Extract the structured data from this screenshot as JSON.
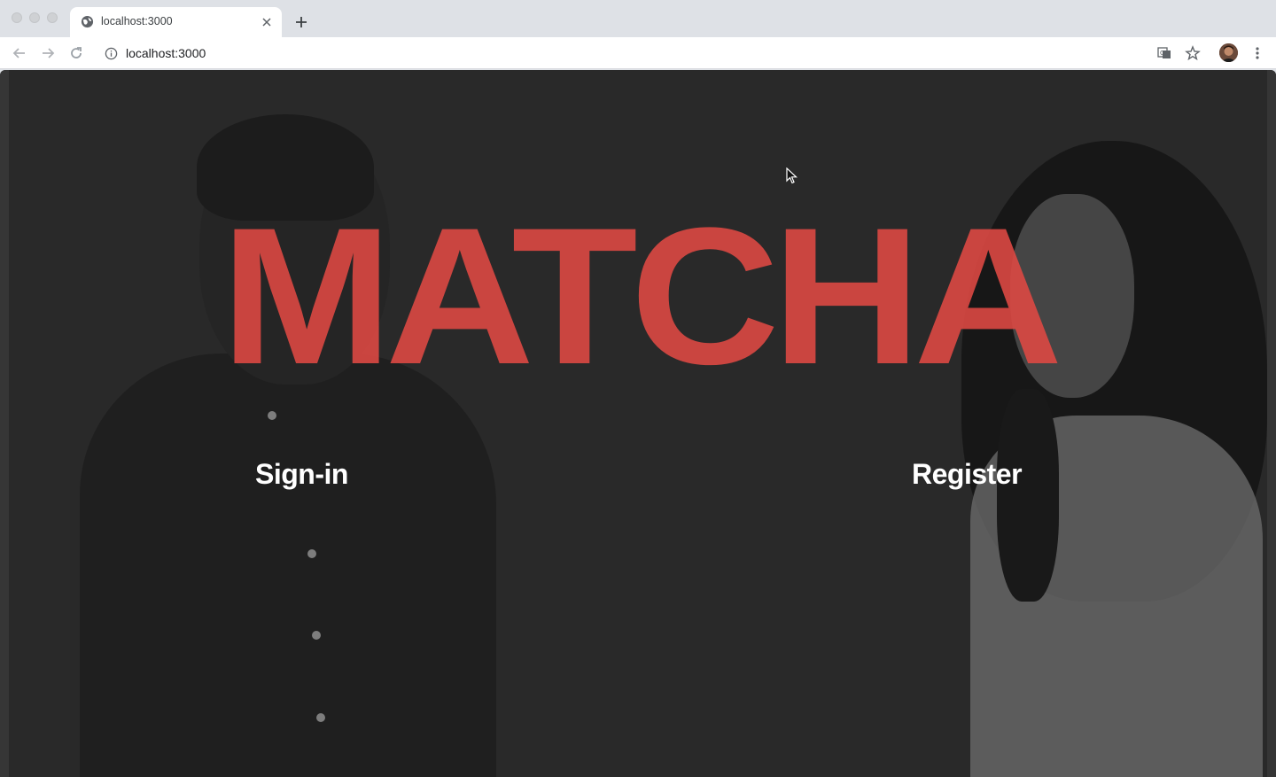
{
  "browser": {
    "tab": {
      "title": "localhost:3000",
      "favicon": "globe-icon"
    },
    "address_bar": {
      "url": "localhost:3000"
    },
    "toolbar_icons": [
      "back-arrow-icon",
      "forward-arrow-icon",
      "reload-icon",
      "info-icon",
      "translate-icon",
      "star-icon",
      "kebab-menu-icon"
    ]
  },
  "page": {
    "brand": {
      "title": "MATCHA",
      "color": "#db4842"
    },
    "links": {
      "signin": "Sign-in",
      "register": "Register"
    },
    "background_color": "#2b2b2b"
  }
}
